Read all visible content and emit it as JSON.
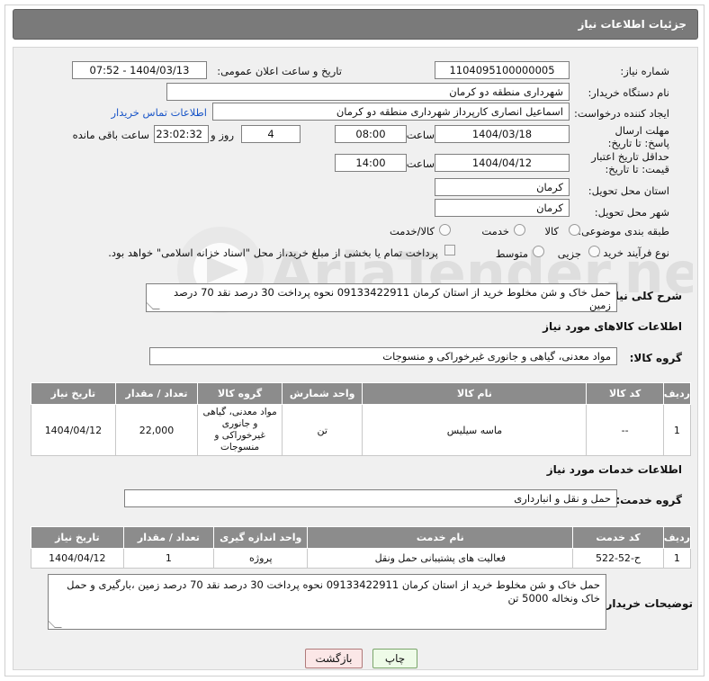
{
  "header": {
    "title": "جزئیات اطلاعات نیاز"
  },
  "fields": {
    "need_number_label": "شماره نیاز:",
    "need_number": "1104095100000005",
    "announce_label": "تاریخ و ساعت اعلان عمومی:",
    "announce_value": "1404/03/13 - 07:52",
    "buyer_org_label": "نام دستگاه خریدار:",
    "buyer_org": "شهرداری منطقه دو کرمان",
    "requester_label": "ایجاد کننده درخواست:",
    "requester": "اسماعیل انصاری کارپرداز شهرداری منطقه دو کرمان",
    "contact_link": "اطلاعات تماس خریدار",
    "deadline_label": "مهلت ارسال پاسخ: تا تاریخ:",
    "deadline_date": "1404/03/18",
    "time_label": "ساعت",
    "deadline_time": "08:00",
    "days_value": "4",
    "days_label": "روز و",
    "remaining_time": "23:02:32",
    "remaining_label": "ساعت باقی مانده",
    "min_price_label": "حداقل تاریخ اعتبار قیمت: تا تاریخ:",
    "min_price_date": "1404/04/12",
    "min_price_time": "14:00",
    "province_label": "استان محل تحویل:",
    "province": "کرمان",
    "city_label": "شهر محل تحویل:",
    "city": "کرمان",
    "category_label": "طبقه بندی موضوعی:",
    "category_options": [
      "کالا",
      "خدمت",
      "کالا/خدمت"
    ],
    "process_label": "نوع فرآیند خرید :",
    "process_options": [
      "جزیی",
      "متوسط"
    ],
    "payment_note": "پرداخت تمام یا بخشی از مبلغ خرید،از محل \"اسناد خزانه اسلامی\" خواهد بود."
  },
  "description": {
    "label": "شرح کلی نیاز:",
    "text": "حمل خاک و شن مخلوط  خرید از استان کرمان 09133422911 نحوه پرداخت 30 درصد نقد 70 درصد زمین"
  },
  "goods": {
    "section_title": "اطلاعات کالاهای مورد نیاز",
    "group_label": "گروه کالا:",
    "group_value": "مواد معدنی، گیاهی و جانوری غیرخوراکی و منسوجات",
    "columns": [
      "ردیف",
      "کد کالا",
      "نام کالا",
      "واحد شمارش",
      "گروه کالا",
      "تعداد / مقدار",
      "تاریخ نیاز"
    ],
    "rows": [
      [
        "1",
        "--",
        "ماسه سیلیس",
        "تن",
        "مواد معدنی، گیاهی و جانوری غیرخوراکی و منسوجات",
        "22,000",
        "1404/04/12"
      ]
    ]
  },
  "services": {
    "section_title": "اطلاعات خدمات مورد نیاز",
    "group_label": "گروه خدمت:",
    "group_value": "حمل و نقل و انبارداری",
    "columns": [
      "ردیف",
      "کد خدمت",
      "نام خدمت",
      "واحد اندازه گیری",
      "تعداد / مقدار",
      "تاریخ نیاز"
    ],
    "rows": [
      [
        "1",
        "ح-52-522",
        "فعالیت های پشتیبانی حمل ونقل",
        "پروژه",
        "1",
        "1404/04/12"
      ]
    ]
  },
  "buyer_notes": {
    "label": "توضیحات خریدار:",
    "text": "حمل خاک و شن مخلوط  خرید از استان کرمان 09133422911 نحوه پرداخت 30 درصد نقد 70 درصد زمین ،بارگیری و حمل خاک ونخاله 5000 تن"
  },
  "buttons": {
    "print": "چاپ",
    "back": "بازگشت"
  },
  "watermark": "AriaTender.neT"
}
